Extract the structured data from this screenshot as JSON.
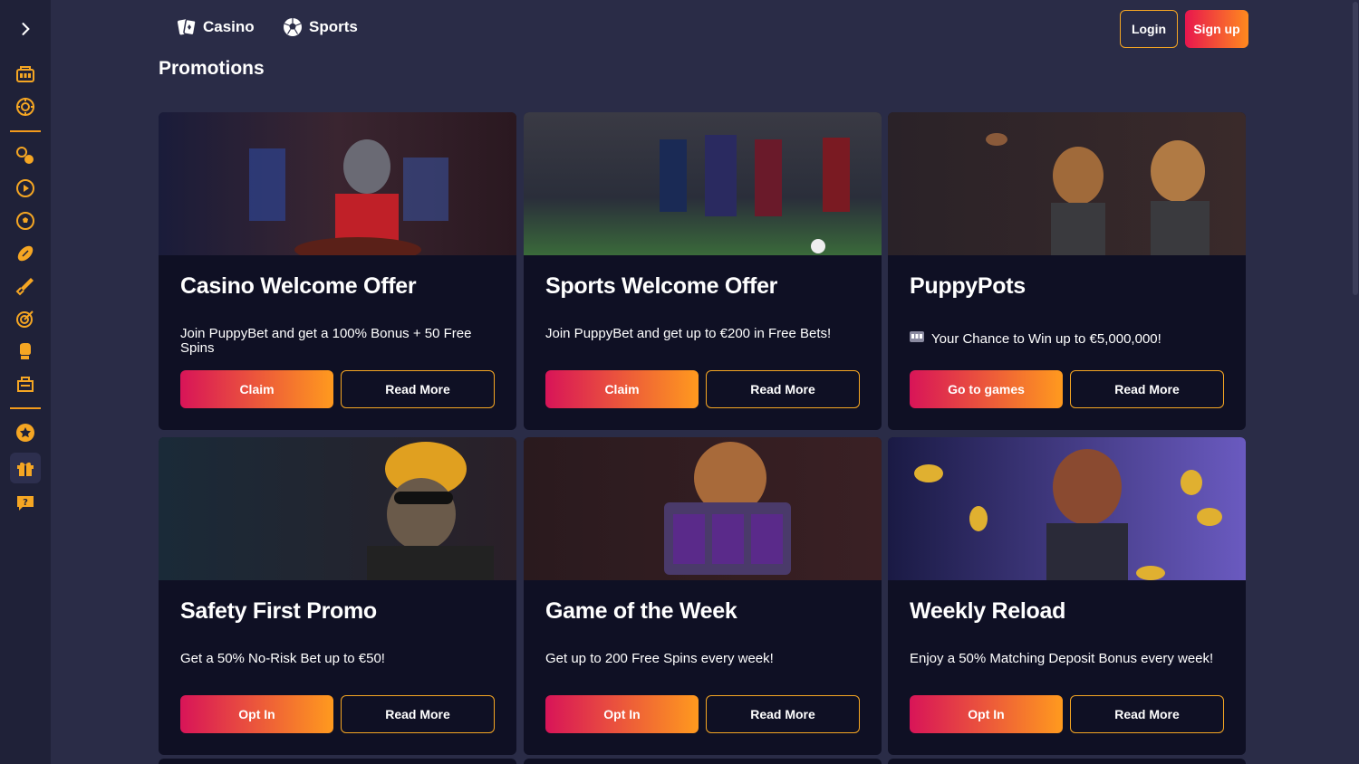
{
  "header": {
    "casino_label": "Casino",
    "sports_label": "Sports",
    "login_label": "Login",
    "signup_label": "Sign up"
  },
  "page": {
    "title": "Promotions"
  },
  "sidebar": {
    "items": [
      {
        "icon": "slot-machine-icon"
      },
      {
        "icon": "roulette-icon"
      },
      {
        "icon": "sports-balls-icon"
      },
      {
        "icon": "live-play-icon"
      },
      {
        "icon": "soccer-ball-icon"
      },
      {
        "icon": "football-icon"
      },
      {
        "icon": "cricket-bat-icon"
      },
      {
        "icon": "darts-target-icon"
      },
      {
        "icon": "boxing-glove-icon"
      },
      {
        "icon": "esports-icon"
      },
      {
        "icon": "star-icon"
      },
      {
        "icon": "gift-icon"
      },
      {
        "icon": "support-chat-icon"
      }
    ]
  },
  "promos": [
    {
      "title": "Casino Welcome Offer",
      "desc": "Join PuppyBet and get a 100% Bonus + 50 Free Spins",
      "primary": "Claim",
      "secondary": "Read More"
    },
    {
      "title": "Sports Welcome Offer",
      "desc": "Join PuppyBet and get up to €200 in Free Bets!",
      "primary": "Claim",
      "secondary": "Read More"
    },
    {
      "title": "PuppyPots",
      "desc": "Your Chance to Win up to €5,000,000!",
      "primary": "Go to games",
      "secondary": "Read More"
    },
    {
      "title": "Safety First Promo",
      "desc": "Get a 50% No-Risk Bet up to €50!",
      "primary": "Opt In",
      "secondary": "Read More"
    },
    {
      "title": "Game of the Week",
      "desc": "Get up to 200 Free Spins every week!",
      "primary": "Opt In",
      "secondary": "Read More"
    },
    {
      "title": "Weekly Reload",
      "desc": "Enjoy a 50% Matching Deposit Bonus every week!",
      "primary": "Opt In",
      "secondary": "Read More"
    }
  ],
  "colors": {
    "accent": "#f5a623",
    "gradient_start": "#d81458",
    "gradient_end": "#ff9a1e",
    "card_bg": "#0f1024",
    "page_bg": "#2a2c47"
  }
}
